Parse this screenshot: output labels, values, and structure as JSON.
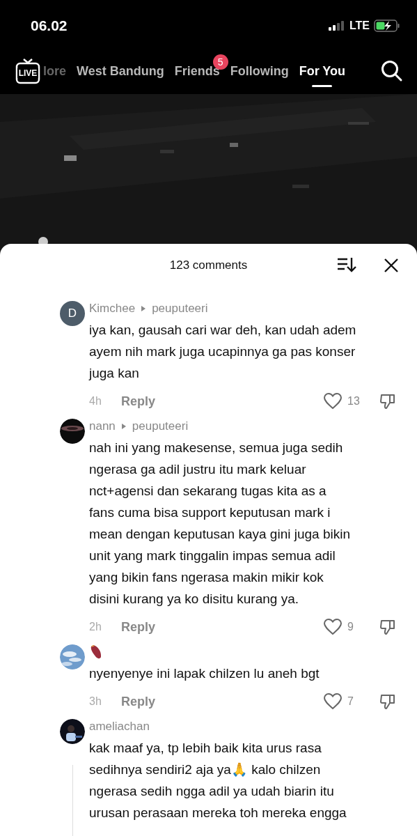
{
  "status_bar": {
    "time": "06.02",
    "network": "LTE"
  },
  "nav": {
    "live_label": "LIVE",
    "tabs": [
      {
        "label": "lore",
        "selected": false,
        "faded": true
      },
      {
        "label": "West Bandung",
        "selected": false,
        "faded": false
      },
      {
        "label": "Friends",
        "selected": false,
        "faded": false,
        "badge": "5"
      },
      {
        "label": "Following",
        "selected": false,
        "faded": false
      },
      {
        "label": "For You",
        "selected": true,
        "faded": false
      }
    ]
  },
  "comments_sheet": {
    "title": "123 comments",
    "comments": [
      {
        "avatar": {
          "kind": "letter",
          "letter": "D"
        },
        "user": "Kimchee",
        "reply_to": "peuputeeri",
        "lines": [
          "iya kan, gausah cari war deh, kan udah adem",
          "ayem nih mark juga ucapinnya ga pas konser",
          "juga kan"
        ],
        "time": "4h",
        "reply": "Reply",
        "likes": "13",
        "thread": false
      },
      {
        "avatar": {
          "kind": "dark"
        },
        "user": "nann",
        "reply_to": "peuputeeri",
        "lines": [
          "nah ini yang makesense, semua juga sedih",
          "ngerasa ga adil justru itu mark keluar",
          "nct+agensi dan sekarang tugas kita as a",
          "fans cuma bisa support keputusan mark i",
          "mean dengan keputusan kaya gini juga bikin",
          "unit yang mark tinggalin impas semua adil",
          "yang bikin fans ngerasa makin mikir kok",
          "disini kurang ya ko disitu kurang ya."
        ],
        "time": "2h",
        "reply": "Reply",
        "likes": "9",
        "thread": false
      },
      {
        "avatar": {
          "kind": "sky"
        },
        "lines": [
          "nyenyenye ini lapak chilzen lu aneh bgt"
        ],
        "time": "3h",
        "reply": "Reply",
        "likes": "7",
        "thread": false
      },
      {
        "avatar": {
          "kind": "figure"
        },
        "user": "ameliachan",
        "lines": [
          "kak maaf ya, tp lebih baik kita urus rasa",
          "sedihnya sendiri2 aja ya🙏 kalo chilzen",
          "ngerasa sedih ngga adil ya udah biarin itu",
          "urusan perasaan mereka toh mereka engga"
        ],
        "thread": true
      }
    ]
  }
}
